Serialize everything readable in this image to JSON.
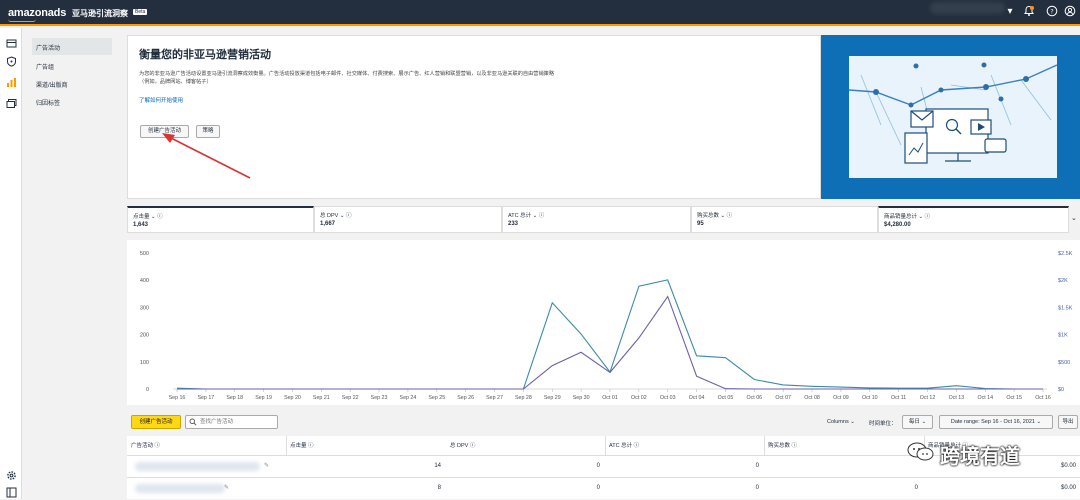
{
  "topbar": {
    "logo": "amazonads",
    "brand": "亚马逊引流洞察",
    "beta": "Beta",
    "chevron": "▾",
    "bell_icon": "bell-icon",
    "help_icon": "help-icon",
    "user_icon": "user-icon"
  },
  "subnav": {
    "items": [
      {
        "label": "广告活动",
        "active": true
      },
      {
        "label": "广告组"
      },
      {
        "label": "渠道/出版商"
      },
      {
        "label": "归因标签"
      }
    ]
  },
  "hero": {
    "title": "衡量您的非亚马逊营销活动",
    "description": "为您的非亚马逊广告活动设置亚马逊引流洞察成效衡量。广告活动投放渠道包括电子邮件、社交媒体、付费搜索、展示广告、红人营销和联盟营销，以及非亚马逊关联的自由营销策略（例如，品牌网站、博客帖子）",
    "link": "了解如何开始使用",
    "create_button": "创建广告活动",
    "strategy_button": "策略"
  },
  "metrics": [
    {
      "label": "点击量",
      "value": "1,643",
      "active": true
    },
    {
      "label": "总 DPV",
      "value": "1,667"
    },
    {
      "label": "ATC 总计",
      "value": "233"
    },
    {
      "label": "购买总数",
      "value": "95"
    },
    {
      "label": "商品销量总计",
      "value": "$4,280.00"
    }
  ],
  "chart_data": {
    "type": "line",
    "x": [
      "Sep 16",
      "Sep 17",
      "Sep 18",
      "Sep 19",
      "Sep 20",
      "Sep 21",
      "Sep 22",
      "Sep 23",
      "Sep 24",
      "Sep 25",
      "Sep 26",
      "Sep 27",
      "Sep 28",
      "Sep 29",
      "Sep 30",
      "Oct 01",
      "Oct 02",
      "Oct 03",
      "Oct 04",
      "Oct 05",
      "Oct 06",
      "Oct 07",
      "Oct 08",
      "Oct 09",
      "Oct 10",
      "Oct 11",
      "Oct 12",
      "Oct 13",
      "Oct 14",
      "Oct 15",
      "Oct 16"
    ],
    "left_ticks": [
      "0",
      "100",
      "200",
      "300",
      "400",
      "500"
    ],
    "right_ticks": [
      "$0",
      "$500",
      "$1K",
      "$1.5K",
      "$2K",
      "$2.5K"
    ],
    "ylim_left": [
      0,
      500
    ],
    "ylim_right": [
      0,
      2500
    ],
    "series": [
      {
        "axis": "left",
        "color": "#3a8aa8",
        "values": [
          3,
          0,
          0,
          0,
          0,
          0,
          0,
          0,
          0,
          0,
          0,
          0,
          0,
          317,
          202,
          62,
          378,
          401,
          122,
          115,
          35,
          15,
          10,
          7,
          4,
          3,
          3,
          12,
          2,
          0,
          0
        ]
      },
      {
        "axis": "right",
        "color": "#6b5fa8",
        "values": [
          0,
          0,
          0,
          0,
          0,
          0,
          0,
          0,
          0,
          0,
          0,
          0,
          0,
          430,
          675,
          305,
          940,
          1700,
          235,
          5,
          0,
          0,
          0,
          0,
          0,
          0,
          0,
          0,
          0,
          0,
          0
        ]
      }
    ]
  },
  "toolbar": {
    "create_button": "创建广告活动",
    "search_placeholder": "查找广告活动",
    "columns": "Columns",
    "time_unit_label": "时间单位：",
    "time_unit_value": "每日",
    "date_range": "Date range: Sep 16 - Oct 16, 2021",
    "export": "导出"
  },
  "table": {
    "headers": [
      "广告活动",
      "点击量",
      "总 DPV",
      "ATC 总计",
      "购买总数",
      "商品销量总计"
    ],
    "rows": [
      {
        "clicks": "14",
        "dpv": "0",
        "atc": "0",
        "purchases": "0",
        "sales": "$0.00"
      },
      {
        "clicks": "8",
        "dpv": "0",
        "atc": "0",
        "purchases": "0",
        "sales": "$0.00"
      }
    ]
  },
  "watermark": {
    "text": "跨境有道"
  }
}
